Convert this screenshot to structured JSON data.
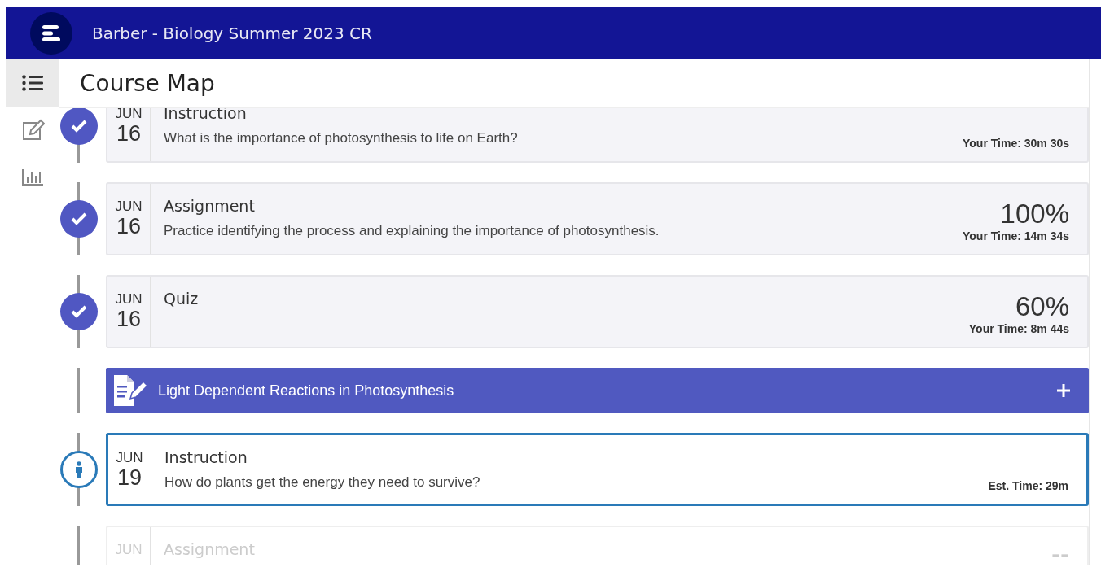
{
  "app_bar": {
    "title": "Barber - Biology Summer 2023 CR"
  },
  "sidebar": {
    "items": [
      {
        "kind": "list",
        "selected": true
      },
      {
        "kind": "edit",
        "selected": false
      },
      {
        "kind": "chart",
        "selected": false
      }
    ]
  },
  "page_title": "Course Map",
  "timeline": [
    {
      "kind": "activity",
      "completed": true,
      "selected": false,
      "month": "JUN",
      "day": "16",
      "title": "Instruction",
      "description": "What is the importance of photosynthesis to life on Earth?",
      "time": "Your Time: 30m 30s"
    },
    {
      "kind": "activity",
      "completed": true,
      "selected": false,
      "month": "JUN",
      "day": "16",
      "title": "Assignment",
      "description": "Practice identifying the process and explaining the importance of photosynthesis.",
      "score": "100%",
      "time": "Your Time: 14m 34s"
    },
    {
      "kind": "activity",
      "completed": true,
      "selected": false,
      "month": "JUN",
      "day": "16",
      "title": "Quiz",
      "score": "60%",
      "time": "Your Time: 8m 44s"
    },
    {
      "kind": "section",
      "title": "Light Dependent Reactions in Photosynthesis",
      "expanded": false
    },
    {
      "kind": "activity",
      "completed": false,
      "selected": true,
      "month": "JUN",
      "day": "19",
      "title": "Instruction",
      "description": "How do plants get the energy they need to survive?",
      "time": "Est. Time: 29m"
    },
    {
      "kind": "activity",
      "completed": false,
      "selected": false,
      "month": "JUN",
      "title": "Assignment",
      "score": "--"
    }
  ]
}
